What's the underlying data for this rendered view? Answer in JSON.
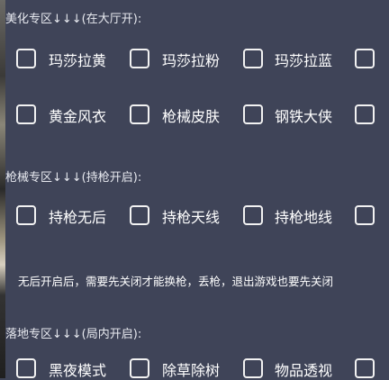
{
  "sections": [
    {
      "header": "美化专区↓↓↓(在大厅开):",
      "rows": [
        [
          "玛莎拉黄",
          "玛莎拉粉",
          "玛莎拉蓝"
        ],
        [
          "黄金风衣",
          "枪械皮肤",
          "钢铁大侠"
        ]
      ]
    },
    {
      "header": "枪械专区↓↓↓(持枪开启):",
      "rows": [
        [
          "持枪无后",
          "持枪天线",
          "持枪地线"
        ]
      ]
    },
    {
      "header": "落地专区↓↓↓(局内开启):",
      "rows": [
        [
          "黑夜模式",
          "除草除树",
          "物品透视"
        ]
      ]
    }
  ],
  "note": "无后开启后，需要先关闭才能换枪，丢枪，退出游戏也要先关闭"
}
